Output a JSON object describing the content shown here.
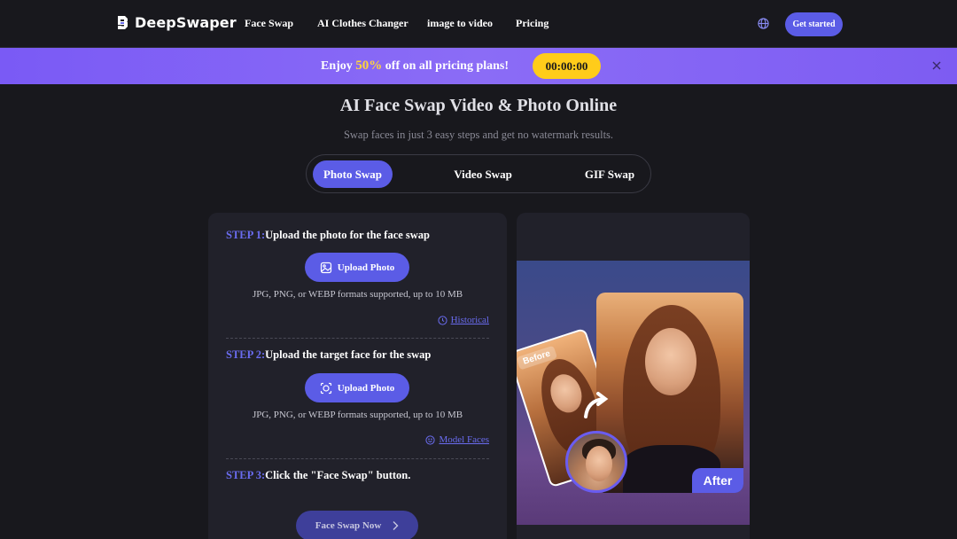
{
  "header": {
    "logo_text": "DeepSwaper",
    "nav": [
      "Face Swap",
      "AI Clothes Changer",
      "image to video",
      "Pricing"
    ],
    "get_started": "Get started"
  },
  "promo": {
    "prefix": "Enjoy ",
    "percent": "50%",
    "suffix": " off on all pricing plans!",
    "timer": "00:00:00"
  },
  "hero": {
    "title": "AI Face Swap Video & Photo Online",
    "subtitle": "Swap faces in just 3 easy steps and get no watermark results."
  },
  "tabs": [
    {
      "label": "Photo Swap",
      "active": true
    },
    {
      "label": "Video Swap",
      "active": false
    },
    {
      "label": "GIF Swap",
      "active": false
    }
  ],
  "steps": [
    {
      "num": "STEP 1:",
      "text": "Upload the photo for the face swap",
      "button": "Upload Photo",
      "formats": "JPG, PNG, or WEBP formats supported, up to 10 MB",
      "link": "Historical"
    },
    {
      "num": "STEP 2:",
      "text": "Upload the target face for the swap",
      "button": "Upload Photo",
      "formats": "JPG, PNG, or WEBP formats supported, up to 10 MB",
      "link": "Model Faces"
    },
    {
      "num": "STEP 3:",
      "text": "Click the \"Face Swap\" button."
    }
  ],
  "swap_button": "Face Swap Now",
  "preview": {
    "before_label": "Before",
    "after_label": "After"
  },
  "colors": {
    "accent": "#5b5ce6",
    "banner": "#7a5af5",
    "timer": "#ffcc1a",
    "percent": "#ffd43b",
    "background": "#18181d"
  },
  "icons": [
    "logo-icon",
    "globe-icon",
    "close-icon",
    "image-upload-icon",
    "face-scan-icon",
    "clock-icon",
    "smile-icon",
    "chevron-right-icon",
    "curved-arrow-icon"
  ]
}
